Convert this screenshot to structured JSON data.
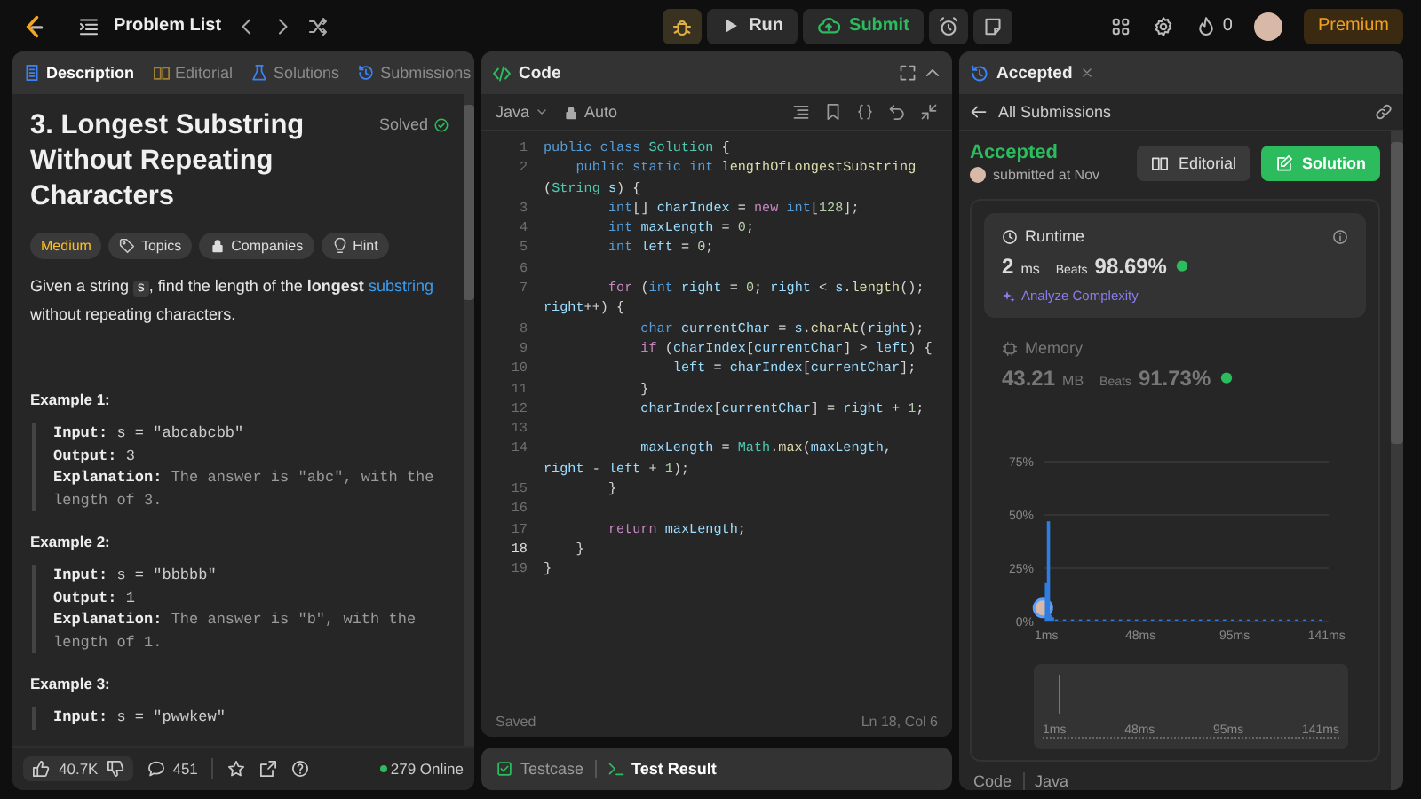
{
  "topbar": {
    "title": "Problem List",
    "run": "Run",
    "submit": "Submit",
    "streak": "0",
    "premium": "Premium"
  },
  "description_panel": {
    "tabs": [
      {
        "label": "Description",
        "selected": true
      },
      {
        "label": "Editorial",
        "selected": false
      },
      {
        "label": "Solutions",
        "selected": false
      },
      {
        "label": "Submissions",
        "selected": false
      }
    ],
    "title": "3. Longest Substring Without Repeating Characters",
    "status": "Solved",
    "tags": [
      {
        "kind": "difficulty",
        "label": "Medium"
      },
      {
        "kind": "topics",
        "label": "Topics"
      },
      {
        "kind": "companies",
        "label": "Companies"
      },
      {
        "kind": "hint",
        "label": "Hint"
      }
    ],
    "statement": [
      {
        "kind": "text",
        "text": "Given a string "
      },
      {
        "kind": "code",
        "text": "s"
      },
      {
        "kind": "text",
        "text": ", find the length of the "
      },
      {
        "kind": "bold",
        "text": "longest "
      },
      {
        "kind": "link",
        "text": "substring"
      },
      {
        "kind": "text",
        "text": " without repeating characters."
      }
    ],
    "examples": [
      {
        "heading": "Example 1:",
        "lines": [
          {
            "kind": "input",
            "label": "Input:",
            "text": "s = \"abcabcbb\""
          },
          {
            "kind": "output",
            "label": "Output:",
            "text": "3"
          },
          {
            "kind": "explanation",
            "label": "Explanation:",
            "text": "The answer is \"abc\", with the length of 3."
          }
        ]
      },
      {
        "heading": "Example 2:",
        "lines": [
          {
            "kind": "input",
            "label": "Input:",
            "text": "s = \"bbbbb\""
          },
          {
            "kind": "output",
            "label": "Output:",
            "text": "1"
          },
          {
            "kind": "explanation",
            "label": "Explanation:",
            "text": "The answer is \"b\", with the length of 1."
          }
        ]
      },
      {
        "heading": "Example 3:",
        "lines": [
          {
            "kind": "input",
            "label": "Input:",
            "text": "s = \"pwwkew\""
          }
        ]
      }
    ],
    "footer": {
      "likes": "40.7K",
      "comments": "451",
      "online": "279 Online"
    }
  },
  "code_panel": {
    "title": "Code",
    "language": "Java",
    "mode": "Auto",
    "rows": [
      {
        "num": "1",
        "current": false,
        "segs": [
          {
            "kind": "kw",
            "text": "public class "
          },
          {
            "kind": "type",
            "text": "Solution"
          },
          {
            "kind": "p",
            "text": " {"
          }
        ]
      },
      {
        "num": "2",
        "current": false,
        "segs": [
          {
            "kind": "kw",
            "text": "    public static int "
          },
          {
            "kind": "fn",
            "text": "lengthOfLongestSubstring"
          }
        ]
      },
      {
        "segs": [
          {
            "kind": "p",
            "text": "("
          },
          {
            "kind": "type",
            "text": "String"
          },
          {
            "kind": "var",
            "text": " s"
          },
          {
            "kind": "p",
            "text": ") {"
          }
        ]
      },
      {
        "num": "3",
        "current": false,
        "segs": [
          {
            "kind": "kw",
            "text": "        int"
          },
          {
            "kind": "p",
            "text": "[] "
          },
          {
            "kind": "var",
            "text": "charIndex"
          },
          {
            "kind": "p",
            "text": " = "
          },
          {
            "kind": "ctl",
            "text": "new "
          },
          {
            "kind": "kw",
            "text": "int"
          },
          {
            "kind": "p",
            "text": "["
          },
          {
            "kind": "num",
            "text": "128"
          },
          {
            "kind": "p",
            "text": "];"
          }
        ]
      },
      {
        "num": "4",
        "current": false,
        "segs": [
          {
            "kind": "kw",
            "text": "        int "
          },
          {
            "kind": "var",
            "text": "maxLength"
          },
          {
            "kind": "p",
            "text": " = "
          },
          {
            "kind": "num",
            "text": "0"
          },
          {
            "kind": "p",
            "text": ";"
          }
        ]
      },
      {
        "num": "5",
        "current": false,
        "segs": [
          {
            "kind": "kw",
            "text": "        int "
          },
          {
            "kind": "var",
            "text": "left"
          },
          {
            "kind": "p",
            "text": " = "
          },
          {
            "kind": "num",
            "text": "0"
          },
          {
            "kind": "p",
            "text": ";"
          }
        ]
      },
      {
        "num": "6",
        "current": false
      },
      {
        "num": "7",
        "current": false,
        "segs": [
          {
            "kind": "ctl",
            "text": "        for"
          },
          {
            "kind": "p",
            "text": " ("
          },
          {
            "kind": "kw",
            "text": "int "
          },
          {
            "kind": "var",
            "text": "right"
          },
          {
            "kind": "p",
            "text": " = "
          },
          {
            "kind": "num",
            "text": "0"
          },
          {
            "kind": "p",
            "text": "; "
          },
          {
            "kind": "var",
            "text": "right"
          },
          {
            "kind": "p",
            "text": " < "
          },
          {
            "kind": "var",
            "text": "s"
          },
          {
            "kind": "p",
            "text": "."
          },
          {
            "kind": "fn",
            "text": "length"
          },
          {
            "kind": "p",
            "text": "();"
          }
        ]
      },
      {
        "segs": [
          {
            "kind": "var",
            "text": "right"
          },
          {
            "kind": "p",
            "text": "++) {"
          }
        ]
      },
      {
        "num": "8",
        "current": false,
        "segs": [
          {
            "kind": "kw",
            "text": "            char "
          },
          {
            "kind": "var",
            "text": "currentChar"
          },
          {
            "kind": "p",
            "text": " = "
          },
          {
            "kind": "var",
            "text": "s"
          },
          {
            "kind": "p",
            "text": "."
          },
          {
            "kind": "fn",
            "text": "charAt"
          },
          {
            "kind": "p",
            "text": "("
          },
          {
            "kind": "var",
            "text": "right"
          },
          {
            "kind": "p",
            "text": ");"
          }
        ]
      },
      {
        "num": "9",
        "current": false,
        "segs": [
          {
            "kind": "ctl",
            "text": "            if"
          },
          {
            "kind": "p",
            "text": " ("
          },
          {
            "kind": "var",
            "text": "charIndex"
          },
          {
            "kind": "p",
            "text": "["
          },
          {
            "kind": "var",
            "text": "currentChar"
          },
          {
            "kind": "p",
            "text": "] > "
          },
          {
            "kind": "var",
            "text": "left"
          },
          {
            "kind": "p",
            "text": ") {"
          }
        ]
      },
      {
        "num": "10",
        "current": false,
        "segs": [
          {
            "kind": "var",
            "text": "                left"
          },
          {
            "kind": "p",
            "text": " = "
          },
          {
            "kind": "var",
            "text": "charIndex"
          },
          {
            "kind": "p",
            "text": "["
          },
          {
            "kind": "var",
            "text": "currentChar"
          },
          {
            "kind": "p",
            "text": "];"
          }
        ]
      },
      {
        "num": "11",
        "current": false,
        "segs": [
          {
            "kind": "p",
            "text": "            }"
          }
        ]
      },
      {
        "num": "12",
        "current": false,
        "segs": [
          {
            "kind": "var",
            "text": "            charIndex"
          },
          {
            "kind": "p",
            "text": "["
          },
          {
            "kind": "var",
            "text": "currentChar"
          },
          {
            "kind": "p",
            "text": "] = "
          },
          {
            "kind": "var",
            "text": "right"
          },
          {
            "kind": "p",
            "text": " + "
          },
          {
            "kind": "num",
            "text": "1"
          },
          {
            "kind": "p",
            "text": ";"
          }
        ]
      },
      {
        "num": "13",
        "current": false
      },
      {
        "num": "14",
        "current": false,
        "segs": [
          {
            "kind": "var",
            "text": "            maxLength"
          },
          {
            "kind": "p",
            "text": " = "
          },
          {
            "kind": "type",
            "text": "Math"
          },
          {
            "kind": "p",
            "text": "."
          },
          {
            "kind": "fn",
            "text": "max"
          },
          {
            "kind": "p",
            "text": "("
          },
          {
            "kind": "var",
            "text": "maxLength"
          },
          {
            "kind": "p",
            "text": ","
          }
        ]
      },
      {
        "segs": [
          {
            "kind": "var",
            "text": "right"
          },
          {
            "kind": "p",
            "text": " - "
          },
          {
            "kind": "var",
            "text": "left"
          },
          {
            "kind": "p",
            "text": " + "
          },
          {
            "kind": "num",
            "text": "1"
          },
          {
            "kind": "p",
            "text": ");"
          }
        ]
      },
      {
        "num": "15",
        "current": false,
        "segs": [
          {
            "kind": "p",
            "text": "        }"
          }
        ]
      },
      {
        "num": "16",
        "current": false
      },
      {
        "num": "17",
        "current": false,
        "segs": [
          {
            "kind": "ctl",
            "text": "        return "
          },
          {
            "kind": "var",
            "text": "maxLength"
          },
          {
            "kind": "p",
            "text": ";"
          }
        ]
      },
      {
        "num": "18",
        "current": true,
        "segs": [
          {
            "kind": "p",
            "text": "    }"
          }
        ]
      },
      {
        "num": "19",
        "current": false,
        "segs": [
          {
            "kind": "p",
            "text": "}"
          }
        ]
      }
    ],
    "status": "Saved",
    "cursor": "Ln 18, Col 6",
    "bottom_tabs": [
      {
        "label": "Testcase",
        "selected": false
      },
      {
        "label": "Test Result",
        "selected": true
      }
    ]
  },
  "result_panel": {
    "tab": "Accepted",
    "back": "All Submissions",
    "status": "Accepted",
    "submitted": "submitted at Nov",
    "buttons": [
      {
        "kind": "editorial",
        "label": "Editorial"
      },
      {
        "kind": "solution",
        "label": "Solution"
      }
    ],
    "metrics": [
      {
        "title": "Runtime",
        "value": "2",
        "unit": "ms",
        "beats_label": "Beats",
        "beats": "98.69%",
        "selected": true,
        "analyze": "Analyze Complexity"
      },
      {
        "title": "Memory",
        "value": "43.21",
        "unit": "MB",
        "beats_label": "Beats",
        "beats": "91.73%",
        "selected": false
      }
    ],
    "chart_data": {
      "type": "bar",
      "x": [
        1,
        2,
        3,
        4,
        6,
        10,
        14,
        18,
        22,
        26,
        30,
        34,
        38,
        42,
        46,
        50,
        54,
        58,
        62,
        66,
        70,
        74,
        78,
        82,
        86,
        90,
        94,
        98,
        102,
        106,
        110,
        114,
        118,
        122,
        126,
        130,
        134,
        138
      ],
      "series": [
        {
          "color": "#2f7de1",
          "values": [
            18,
            47,
            3,
            2,
            1,
            1,
            1,
            1,
            1,
            1,
            1,
            1,
            1,
            1,
            1,
            1,
            1,
            1,
            1,
            1,
            1,
            1,
            1,
            1,
            1,
            1,
            1,
            1,
            1,
            1,
            1,
            1,
            1,
            1,
            1,
            1,
            1,
            1
          ]
        }
      ],
      "xlim": [
        0,
        142
      ],
      "ylim": [
        0,
        75
      ],
      "xticks": [
        {
          "value": 1,
          "label": "1ms"
        },
        {
          "value": 48,
          "label": "48ms"
        },
        {
          "value": 95,
          "label": "95ms"
        },
        {
          "value": 141,
          "label": "141ms"
        }
      ],
      "yticks": [
        {
          "value": 0,
          "label": "0%"
        },
        {
          "value": 25,
          "label": "25%"
        },
        {
          "value": 50,
          "label": "50%"
        },
        {
          "value": 75,
          "label": "75%"
        }
      ]
    },
    "range_labels": [
      "1ms",
      "48ms",
      "95ms",
      "141ms"
    ],
    "footer": {
      "label": "Code",
      "language": "Java"
    }
  }
}
